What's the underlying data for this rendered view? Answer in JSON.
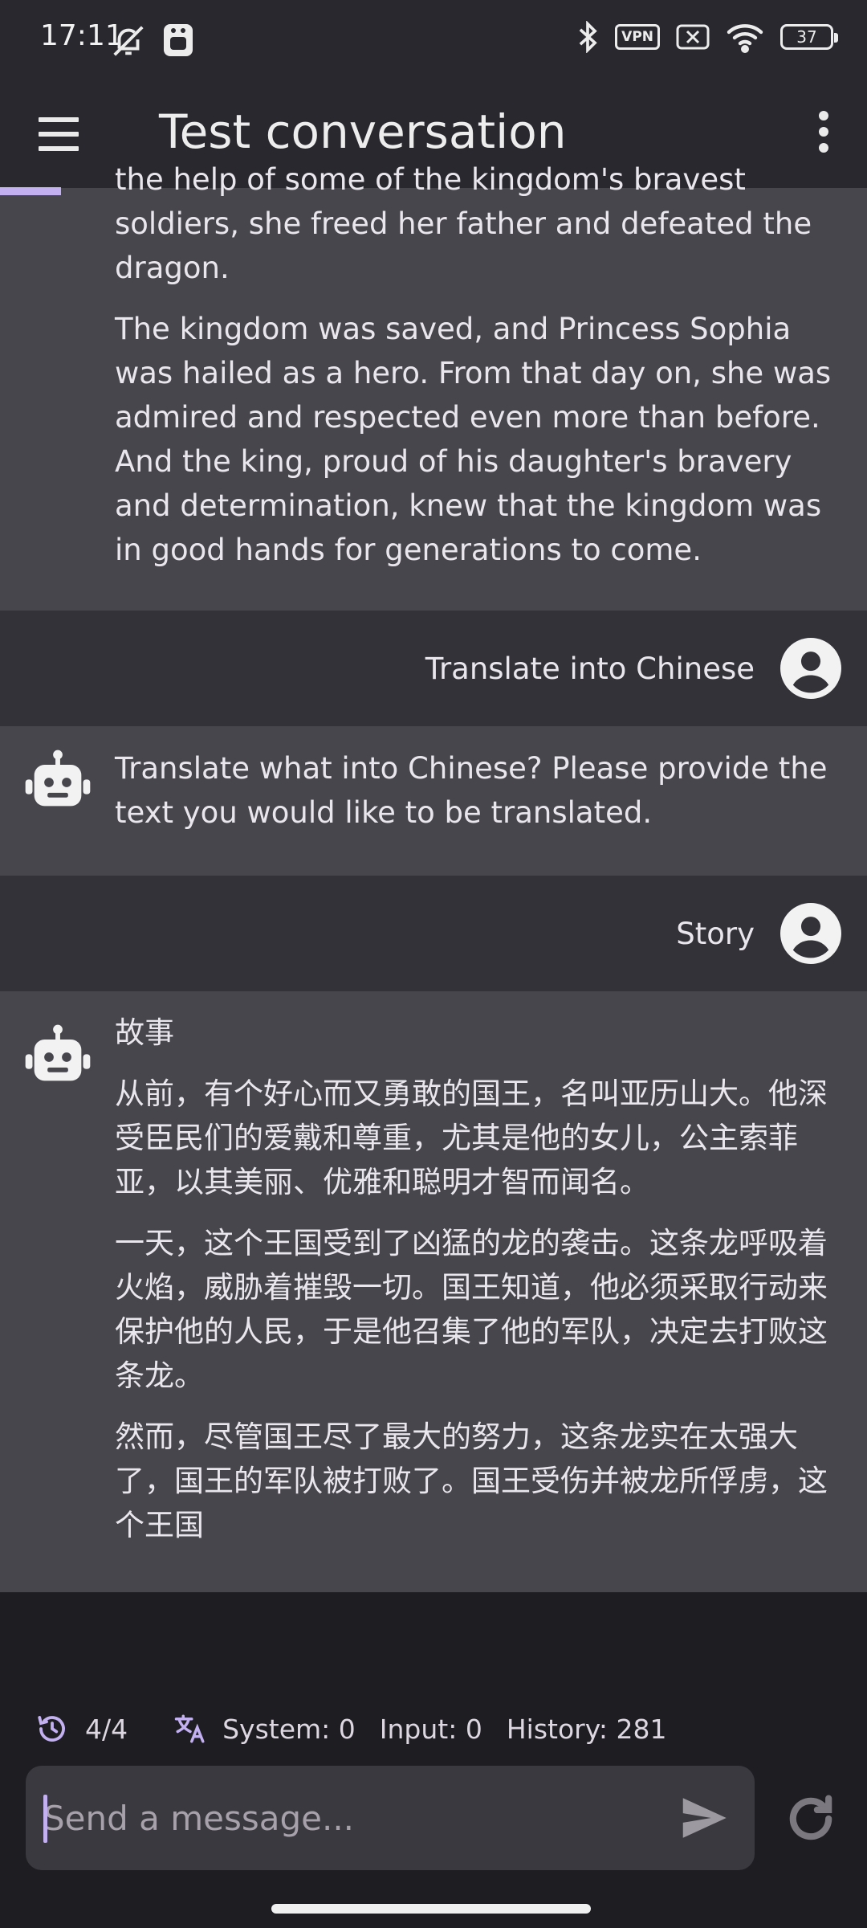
{
  "status_bar": {
    "time": "17:11",
    "vpn_label": "VPN",
    "battery_level": "37"
  },
  "app_bar": {
    "title": "Test conversation"
  },
  "messages": [
    {
      "role": "assistant",
      "paragraphs": [
        "the help of some of the kingdom's bravest soldiers, she freed her father and defeated the dragon.",
        "The kingdom was saved, and Princess Sophia was hailed as a hero. From that day on, she was admired and respected even more than before. And the king, proud of his daughter's bravery and determination, knew that the kingdom was in good hands for generations to come."
      ]
    },
    {
      "role": "user",
      "text": "Translate into Chinese"
    },
    {
      "role": "assistant",
      "paragraphs": [
        "Translate what into Chinese? Please provide the text you would like to be translated."
      ]
    },
    {
      "role": "user",
      "text": "Story"
    },
    {
      "role": "assistant",
      "paragraphs": [
        "故事",
        "从前，有个好心而又勇敢的国王，名叫亚历山大。他深受臣民们的爱戴和尊重，尤其是他的女儿，公主索菲亚，以其美丽、优雅和聪明才智而闻名。",
        "一天，这个王国受到了凶猛的龙的袭击。这条龙呼吸着火焰，威胁着摧毁一切。国王知道，他必须采取行动来保护他的人民，于是他召集了他的军队，决定去打败这条龙。",
        "然而，尽管国王尽了最大的努力，这条龙实在太强大了，国王的军队被打败了。国王受伤并被龙所俘虏，这个王国"
      ]
    }
  ],
  "footer": {
    "history_count": "4/4",
    "system_tokens": "System: 0",
    "input_tokens": "Input: 0",
    "history_tokens": "History: 281",
    "placeholder": "Send a message..."
  },
  "icons": {
    "menu": "menu-icon",
    "more": "more-vert-icon",
    "bot": "robot-icon",
    "user": "account-circle-icon",
    "history": "history-icon",
    "translate": "translate-icon",
    "send": "send-icon",
    "refresh": "refresh-icon"
  },
  "colors": {
    "accent": "#c3b0f0",
    "bar_bg": "#29282e",
    "bot_bg": "#47464c",
    "user_bg": "#333238",
    "page_bg": "#1e1d22"
  }
}
